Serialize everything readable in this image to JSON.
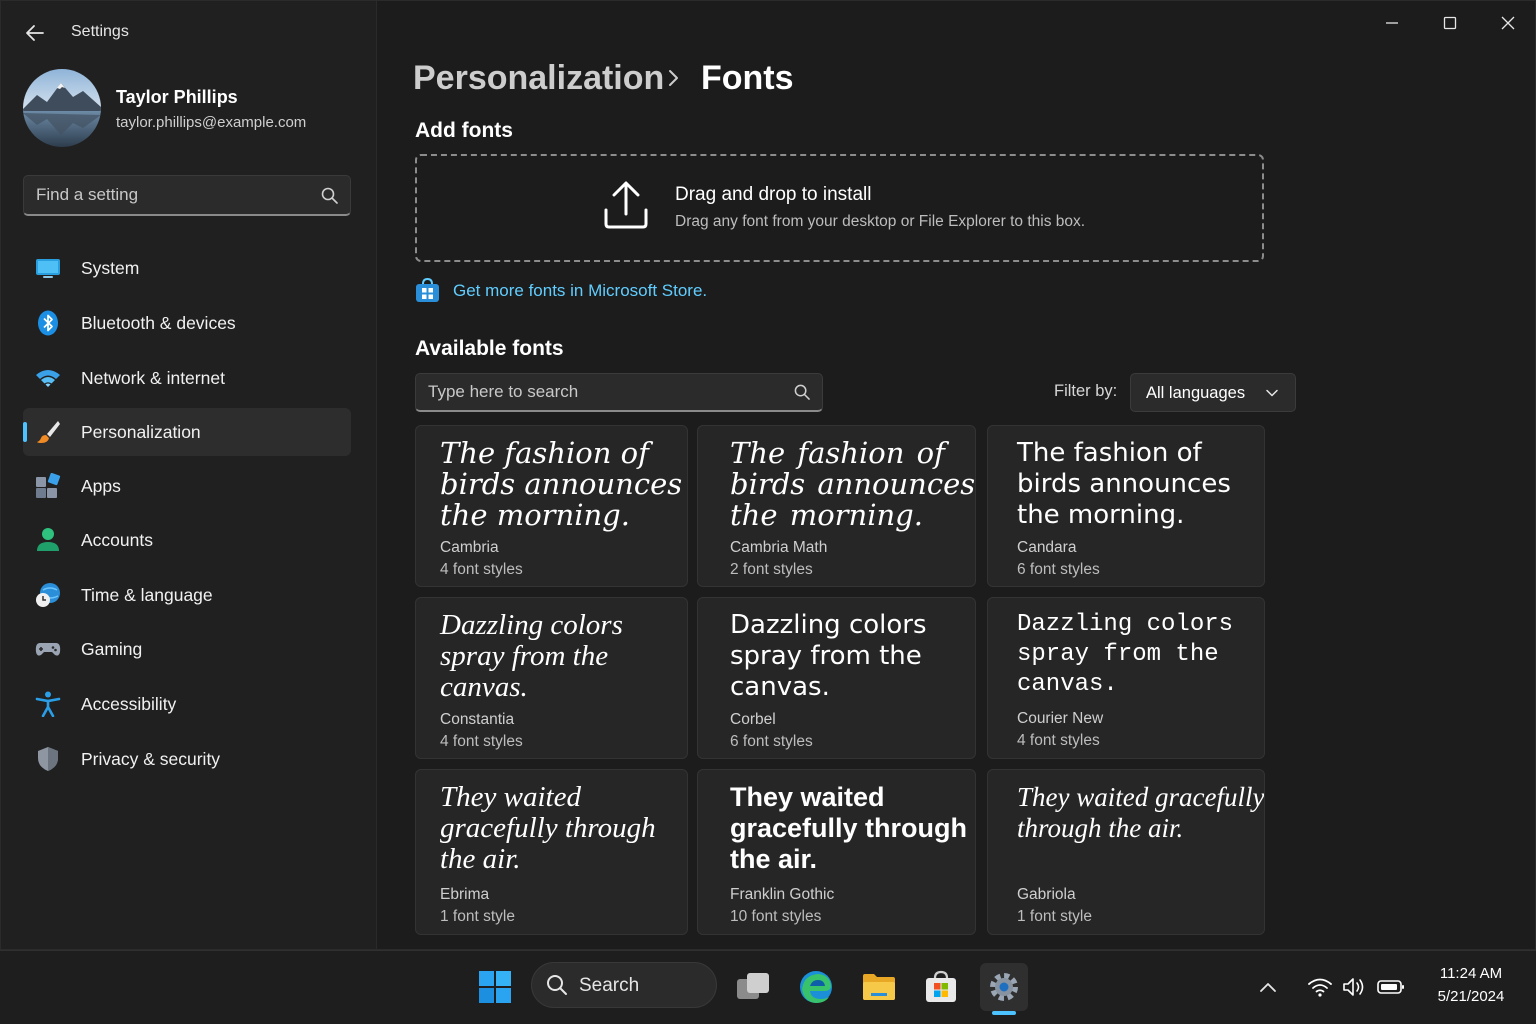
{
  "app": {
    "title": "Settings"
  },
  "user": {
    "name": "Taylor Phillips",
    "email": "taylor.phillips@example.com"
  },
  "sidebar": {
    "search_placeholder": "Find a setting",
    "items": [
      {
        "label": "System",
        "icon": "monitor-icon"
      },
      {
        "label": "Bluetooth & devices",
        "icon": "bluetooth-icon"
      },
      {
        "label": "Network & internet",
        "icon": "wifi-icon"
      },
      {
        "label": "Personalization",
        "icon": "paintbrush-icon",
        "active": true
      },
      {
        "label": "Apps",
        "icon": "apps-icon"
      },
      {
        "label": "Accounts",
        "icon": "person-icon"
      },
      {
        "label": "Time & language",
        "icon": "clock-globe-icon"
      },
      {
        "label": "Gaming",
        "icon": "gamepad-icon"
      },
      {
        "label": "Accessibility",
        "icon": "accessibility-icon"
      },
      {
        "label": "Privacy & security",
        "icon": "shield-icon"
      }
    ]
  },
  "breadcrumb": {
    "parent": "Personalization",
    "current": "Fonts"
  },
  "add_fonts": {
    "title": "Add fonts",
    "drop_title": "Drag and drop to install",
    "drop_subtitle": "Drag any font from your desktop or File Explorer to this box.",
    "store_link": "Get more fonts in Microsoft Store."
  },
  "available_fonts": {
    "title": "Available fonts",
    "search_placeholder": "Type here to search",
    "filter_label": "Filter by:",
    "filter_value": "All languages",
    "fonts": [
      {
        "sample": "The fashion of birds announces the morning.",
        "name": "Cambria",
        "styles": "4 font styles"
      },
      {
        "sample": "The fashion of birds announces the morning.",
        "name": "Cambria Math",
        "styles": "2 font styles"
      },
      {
        "sample": "The fashion of birds announces the morning.",
        "name": "Candara",
        "styles": "6 font styles"
      },
      {
        "sample": "Dazzling colors spray from the canvas.",
        "name": "Constantia",
        "styles": "4 font styles"
      },
      {
        "sample": "Dazzling colors spray from the canvas.",
        "name": "Corbel",
        "styles": "6 font styles"
      },
      {
        "sample": "Dazzling colors spray from the canvas.",
        "name": "Courier New",
        "styles": "4 font styles"
      },
      {
        "sample": "They waited gracefully through the air.",
        "name": "Ebrima",
        "styles": "1 font style"
      },
      {
        "sample": "They waited gracefully through the air.",
        "name": "Franklin Gothic",
        "styles": "10 font styles"
      },
      {
        "sample": "They waited gracefully through the air.",
        "name": "Gabriola",
        "styles": "1 font style"
      }
    ]
  },
  "taskbar": {
    "search_label": "Search",
    "time": "11:24 AM",
    "date": "5/21/2024"
  },
  "colors": {
    "accent": "#4cc2ff",
    "link": "#60cdff",
    "background": "#1c1c1c",
    "sidebar": "#202020"
  }
}
